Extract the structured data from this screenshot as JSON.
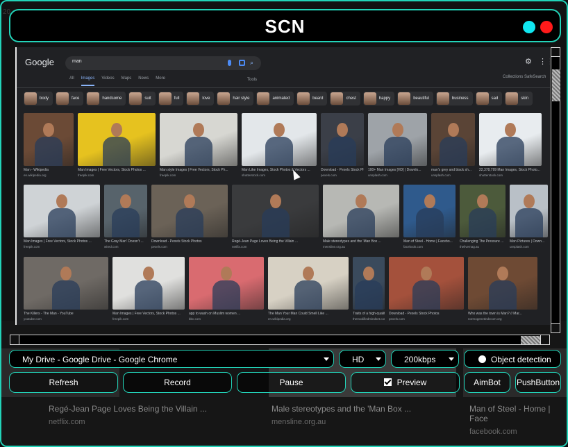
{
  "window": {
    "title": "SCN",
    "corner_label": "20"
  },
  "preview": {
    "google": {
      "logo": "Google",
      "query": "man",
      "tabs": [
        "All",
        "Images",
        "Videos",
        "Maps",
        "News",
        "More"
      ],
      "active_tab": "Images",
      "tools": "Tools",
      "collections": "Collections  SafeSearch",
      "chips": [
        "body",
        "face",
        "handsome",
        "suit",
        "full",
        "love",
        "hair style",
        "animated",
        "beard",
        "chest",
        "happy",
        "beautiful",
        "business",
        "sad",
        "skin"
      ],
      "rows": [
        [
          {
            "caption": "Man - Wikipedia",
            "source": "en.wikipedia.org",
            "color": "#6b4a36"
          },
          {
            "caption": "Man Images | Free Vectors, Stock Photos ...",
            "source": "freepik.com",
            "color": "#e6c21f"
          },
          {
            "caption": "Man style Images | Free Vectors, Stock Ph...",
            "source": "freepik.com",
            "color": "#d7d7d2"
          },
          {
            "caption": "Man Like Images, Stock Photos & Vectors ...",
            "source": "shutterstock.com",
            "color": "#e3e7ea"
          },
          {
            "caption": "Download - Pexels Stock Pho...",
            "source": "pexels.com",
            "color": "#3b3f48"
          },
          {
            "caption": "100+ Man Images [HD] | Downlo...",
            "source": "unsplash.com",
            "color": "#9ea3a8"
          },
          {
            "caption": "man's grey and black sh...",
            "source": "unsplash.com",
            "color": "#5a4436"
          },
          {
            "caption": "22,378,799 Man Images, Stock Photo...",
            "source": "shutterstock.com",
            "color": "#e8ecef"
          }
        ],
        [
          {
            "caption": "Man Images | Free Vectors, Stock Photos ...",
            "source": "freepik.com",
            "color": "#cfd3d6"
          },
          {
            "caption": "The Gray Man' Doesn't ...",
            "source": "wired.com",
            "color": "#57636b"
          },
          {
            "caption": "Download - Pexels Stock Photos",
            "source": "pexels.com",
            "color": "#6b6257"
          },
          {
            "caption": "Regé-Jean Page Loves Being the Villain ...",
            "source": "netflix.com",
            "color": "#3a3b3d"
          },
          {
            "caption": "Male stereotypes and the 'Man Box ...",
            "source": "mensline.org.au",
            "color": "#b7b8b4"
          },
          {
            "caption": "Man of Steel - Home | Facebo...",
            "source": "facebook.com",
            "color": "#2f5a8c"
          },
          {
            "caption": "Challenging The Pressure ...",
            "source": "thelivemag.au",
            "color": "#4c5a3b"
          },
          {
            "caption": "Man Pictures | Down...",
            "source": "unsplash.com",
            "color": "#b9c0c7"
          }
        ],
        [
          {
            "caption": "The Killers - The Man - YouTube",
            "source": "youtube.com",
            "color": "#6f6a65"
          },
          {
            "caption": "Man Images | Free Vectors, Stock Photos ...",
            "source": "freepik.com",
            "color": "#e0e0de"
          },
          {
            "caption": "app to wash on Muslim women ...",
            "source": "bbc.com",
            "color": "#d96b70"
          },
          {
            "caption": "The Man Your Man Could Smell Like ...",
            "source": "en.wikipedia.org",
            "color": "#d7d1c4"
          },
          {
            "caption": "Traits of a high-quality...",
            "source": "themodifiedmindset.com",
            "color": "#3a4a5c"
          },
          {
            "caption": "Download - Pexels Stock Photos",
            "source": "pexels.com",
            "color": "#a4513c"
          },
          {
            "caption": "Who was the town is Man? // Mar...",
            "source": "normogenetindvcom.org",
            "color": "#6e4a34"
          }
        ]
      ]
    }
  },
  "background_captions": [
    {
      "title": "Regé-Jean Page Loves Being the Villain ...",
      "source": "netflix.com"
    },
    {
      "title": "Male stereotypes and the 'Man Box ...",
      "source": "mensline.org.au"
    },
    {
      "title": "Man of Steel - Home | Face",
      "source": "facebook.com"
    }
  ],
  "controls": {
    "window_select": "My Drive - Google Drive - Google Chrome",
    "quality_select": "HD",
    "bitrate_select": "200kbps",
    "object_detection_label": "Object detection",
    "refresh_label": "Refresh",
    "record_label": "Record",
    "pause_label": "Pause",
    "preview_label": "Preview",
    "preview_checked": true,
    "aimbot_label": "AimBot",
    "pushbutton_label": "PushButton"
  },
  "colors": {
    "accent": "#22d3b8",
    "close_dot": "#ff1a1a",
    "min_dot": "#10e6f0"
  }
}
